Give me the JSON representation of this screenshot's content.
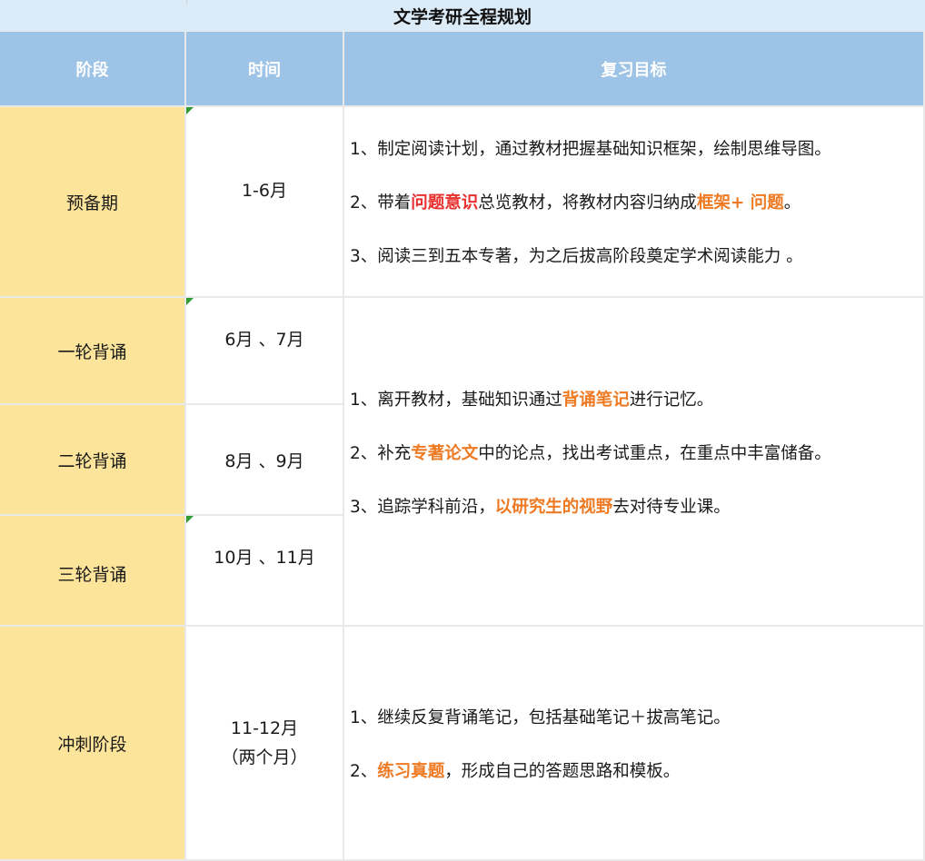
{
  "title": "文学考研全程规划",
  "headers": {
    "stage": "阶段",
    "time": "时间",
    "goal": "复习目标"
  },
  "rows": {
    "r1": {
      "stage": "预备期",
      "time": "1-6月",
      "goals": [
        {
          "a": "1、制定阅读计划，通过教材把握基础知识框架，绘制思维导图。"
        },
        {
          "a": "2、带着",
          "b": "问题意识",
          "c": "总览教材，将教材内容归纳成",
          "d": "框架+ 问题",
          "e": "。"
        },
        {
          "a": "3、阅读三到五本专著，为之后拔高阶段奠定学术阅读能力 。"
        }
      ]
    },
    "r2": {
      "stage": "一轮背诵",
      "time": "6月 、7月"
    },
    "r3": {
      "stage": "二轮背诵",
      "time": "8月 、9月"
    },
    "r4": {
      "stage": "三轮背诵",
      "time": "10月 、11月"
    },
    "group": {
      "goals": [
        {
          "a": "1、离开教材，基础知识通过",
          "b": "背诵笔记",
          "c": "进行记忆。"
        },
        {
          "a": "2、补充",
          "b": "专著论文",
          "c": "中的论点，找出考试重点，在重点中丰富储备。"
        },
        {
          "a": "3、追踪学科前沿，",
          "b": "以研究生的视野",
          "c": "去对待专业课。"
        }
      ]
    },
    "r5": {
      "stage": "冲刺阶段",
      "time_line1": "11-12月",
      "time_line2": "（两个月）",
      "goals": [
        {
          "a": "1、继续反复背诵笔记，包括基础笔记＋拔高笔记。"
        },
        {
          "a": "2、",
          "b": "练习真题",
          "c": "，形成自己的答题思路和模板。"
        }
      ]
    }
  },
  "colors": {
    "title_bg": "#dcebf8",
    "header_bg": "#9dc3e6",
    "stage_bg": "#fde49b",
    "highlight_red": "#e8302f",
    "highlight_orange": "#ee7a24",
    "grid": "#e9e9e9",
    "comment_flag": "#2e9a33"
  }
}
